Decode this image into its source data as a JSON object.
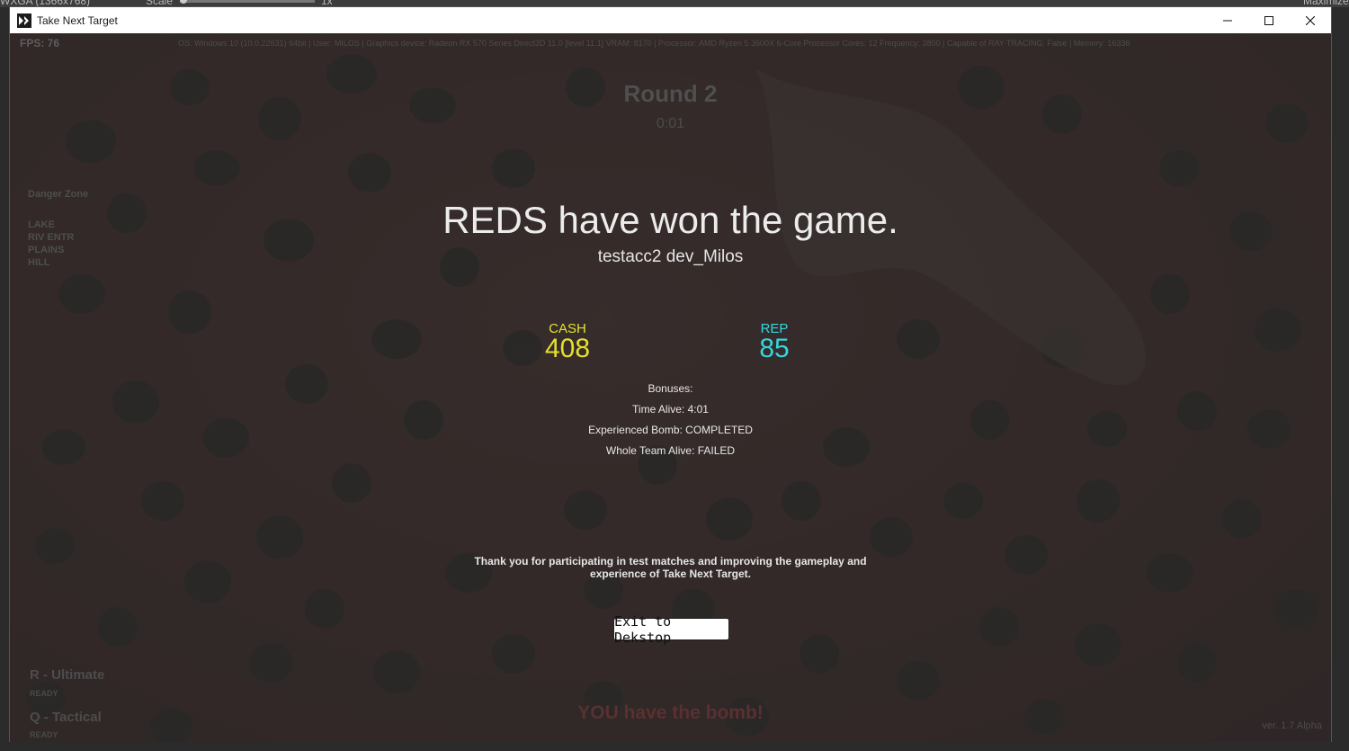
{
  "editor": {
    "resolution": "WXGA (1366x768)",
    "scale_label": "Scale",
    "scale_value": "1x",
    "maximize": "Maximize"
  },
  "window": {
    "title": "Take Next Target",
    "icon": "app-logo-icon",
    "controls": [
      "minimize-icon",
      "maximize-icon",
      "close-icon"
    ]
  },
  "hud": {
    "fps": "FPS: 76",
    "system_info": "OS: Windows 10  (10.0.22631) 64bit | User: MILOS | Graphics device: Radeon RX 570 Series Direct3D 11.0 [level 11.1] VRAM: 8170 | Processor: AMD Ryzen 5 3600X 6-Core Processor  Cores: 12 Frequency: 3800 | Capable of RAY-TRACING: False | Memory: 16336",
    "round": "Round 2",
    "timer": "0:01",
    "left_panel": [
      "Danger Zone",
      "",
      "LAKE",
      "RIV ENTR",
      "PLAINS",
      "HILL"
    ],
    "ability_r": "R - Ultimate",
    "ability_r_state": "READY",
    "ability_q": "Q - Tactical",
    "ability_q_state": "READY",
    "bomb_message": "YOU have the bomb!",
    "version": "ver. 1.7 Alpha"
  },
  "result": {
    "headline": "REDS have won the game.",
    "players": "testacc2 dev_Milos",
    "cash_label": "CASH",
    "cash_value": "408",
    "rep_label": "REP",
    "rep_value": "85",
    "bonuses_header": "Bonuses:",
    "bonus_time_alive": "Time Alive: 4:01",
    "bonus_experienced_bomb": "Experienced Bomb: COMPLETED",
    "bonus_whole_team": "Whole Team Alive: FAILED",
    "thanks_line1": "Thank you for participating in test matches and improving the gameplay and",
    "thanks_line2": "experience of Take Next Target.",
    "exit_button": "Exit to Dekstop"
  },
  "colors": {
    "cash": "#e5e12a",
    "rep": "#35d6e0",
    "overlay": "#282828",
    "map_base": "#5a302c"
  }
}
